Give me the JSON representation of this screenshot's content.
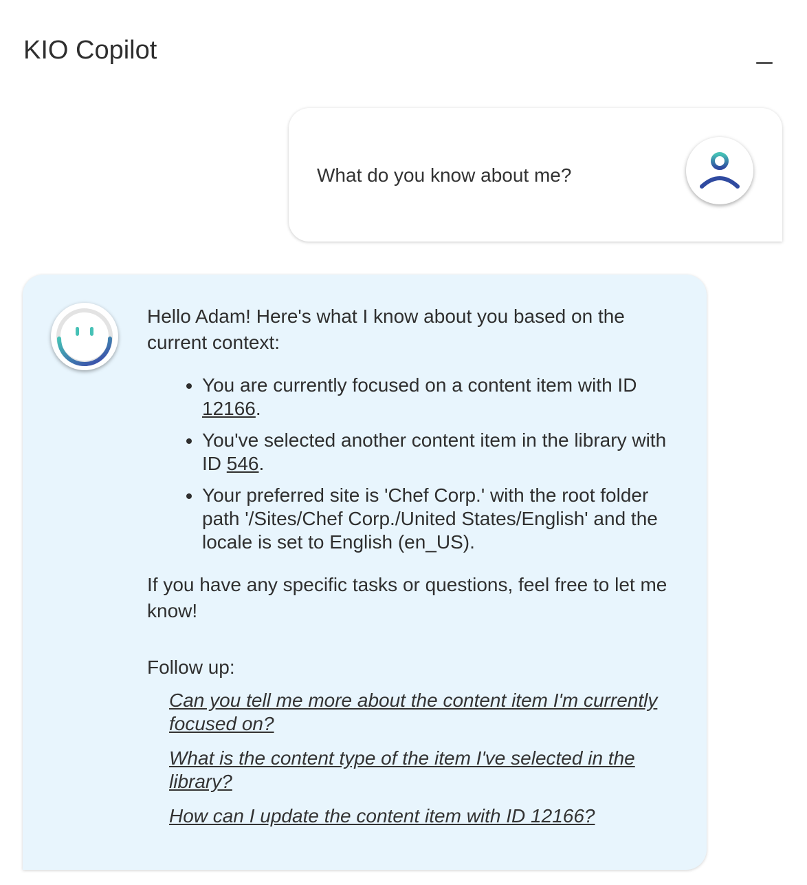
{
  "header": {
    "title": "KIO Copilot",
    "minimize_icon": "minimize-icon"
  },
  "user_message": {
    "text": "What do you know about me?",
    "avatar_icon": "user-avatar-icon"
  },
  "bot_message": {
    "avatar_icon": "smiley-bot-icon",
    "intro": "Hello Adam! Here's what I know about you based on the current context:",
    "facts": [
      {
        "before": "You are currently focused on a content item with ID ",
        "link": "12166",
        "after": "."
      },
      {
        "before": "You've selected another content item in the library with ID ",
        "link": "546",
        "after": "."
      },
      {
        "before": "Your preferred site is 'Chef Corp.' with the root folder path '/Sites/Chef Corp./United States/English' and the locale is set to English (en_US).",
        "link": "",
        "after": ""
      }
    ],
    "closing": "If you have any specific tasks or questions, feel free to let me know!",
    "followup_label": "Follow up:",
    "followups": [
      "Can you tell me more about the content item I'm currently focused on?",
      "What is the content type of the item I've selected in the library?",
      "How can I update the content item with ID 12166?"
    ]
  },
  "colors": {
    "bot_bubble_bg": "#e8f5fd",
    "user_bubble_bg": "#ffffff",
    "accent_teal": "#3fb6b6",
    "accent_blue": "#2e3f9e"
  }
}
